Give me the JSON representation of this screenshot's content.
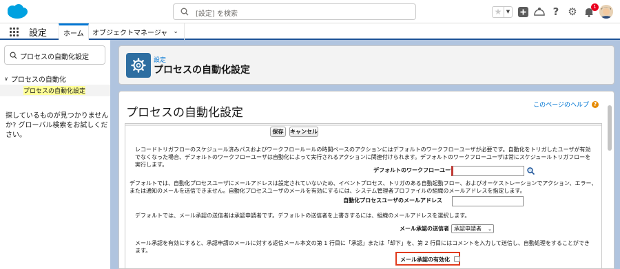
{
  "header": {
    "search_placeholder": "[設定] を検索",
    "notification_count": "1",
    "icons": [
      "salesforce-cloud-logo",
      "favorites-star-icon",
      "add-icon",
      "trailhead-icon",
      "help-icon",
      "gear-icon",
      "bell-icon",
      "avatar"
    ]
  },
  "context_bar": {
    "app_name": "設定",
    "tabs": [
      {
        "label": "ホーム"
      },
      {
        "label": "オブジェクトマネージャ"
      }
    ]
  },
  "sidebar": {
    "search_value": "プロセスの自動化設定",
    "parent_item": "プロセスの自動化",
    "child_item": "プロセスの自動化設定",
    "help_text": "探しているものが見つかりませんか? グローバル検索をお試しください。"
  },
  "page_header": {
    "breadcrumb": "設定",
    "title": "プロセスの自動化設定"
  },
  "main": {
    "title": "プロセスの自動化設定",
    "help_link": "このページのヘルプ",
    "save_button": "保存",
    "cancel_button": "キャンセル",
    "para1": "レコードトリガフローのスケジュール済みパスおよびワークフロールールの時間ベースのアクションにはデフォルトのワークフローユーザが必要です。自動化をトリガしたユーザが有効でなくなった場合、デフォルトのワークフローユーザは自動化によって実行されるアクションに関連付けられます。デフォルトのワークフローユーザは常にスケジュールトリガフローを実行します。",
    "default_workflow_user_label": "デフォルトのワークフローユーザ",
    "default_workflow_user_value": "",
    "para2": "デフォルトでは、自動化プロセスユーザにメールアドレスは設定されていないため、イベントプロセス、トリガのある自動起動フロー、およびオーケストレーションでアクション、エラー、または通知のメールを送信できません。自動化プロセスユーザのメールを有効にするには、システム管理者プロファイルの組織のメールアドレスを指定します。",
    "auto_process_email_label": "自動化プロセスユーザのメールアドレス",
    "auto_process_email_value": "",
    "para3": "デフォルトでは、メール承認の送信者は承認申請者です。デフォルトの送信者を上書きするには、組織のメールアドレスを選択します。",
    "approval_sender_label": "メール承認の送信者",
    "approval_sender_value": "承認申請者",
    "para4": "メール承認を有効にすると、承認申請のメールに対する返信メール本文の第 1 行目に「承認」または「却下」を、第 2 行目にはコメントを入力して送信し、自動処理をすることができます。",
    "enable_email_approval_label": "メール承認の有効化",
    "enable_email_approval_checked": false
  },
  "colors": {
    "accent": "#0176d3",
    "icon_tile": "#2e6ea1",
    "highlight_border": "#e03a1d",
    "required_bar": "#c23934",
    "selection_highlight": "#ffff99"
  }
}
